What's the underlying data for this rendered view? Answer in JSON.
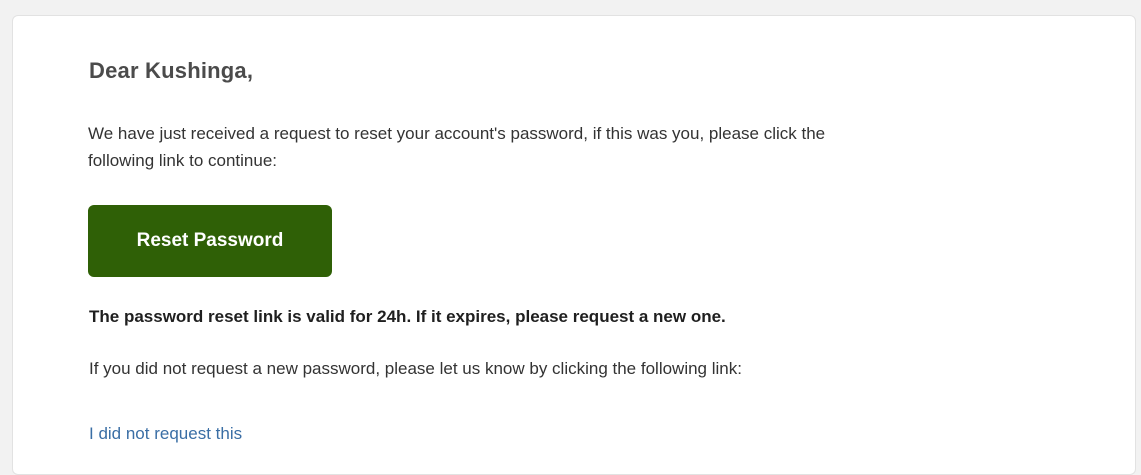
{
  "email": {
    "greeting": "Dear Kushinga,",
    "intro_text": "We have just received a request to reset your account's password, if this was you, please click the following link to continue:",
    "reset_button_label": "Reset Password",
    "validity_notice": "The password reset link is valid for 24h. If it expires, please request a new one.",
    "not_requested_text": "If you did not request a new password, please let us know by clicking the following link:",
    "not_requested_link": "I did not request this"
  },
  "colors": {
    "page_background": "#f2f2f2",
    "card_background": "#ffffff",
    "button_background": "#2f6006",
    "button_text": "#ffffff",
    "link": "#3a6ea5",
    "greeting_text": "#4b4b4b",
    "body_text": "#333333"
  }
}
